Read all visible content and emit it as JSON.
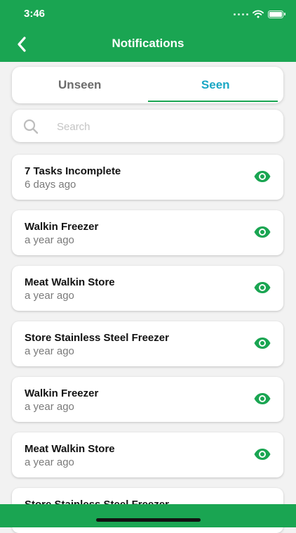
{
  "status_bar": {
    "time": "3:46"
  },
  "header": {
    "title": "Notifications"
  },
  "tabs": [
    {
      "label": "Unseen",
      "active": false
    },
    {
      "label": "Seen",
      "active": true
    }
  ],
  "search": {
    "placeholder": "Search",
    "value": ""
  },
  "notifications": [
    {
      "title": "7 Tasks Incomplete",
      "time": "6 days ago"
    },
    {
      "title": "Walkin Freezer",
      "time": "a year ago"
    },
    {
      "title": "Meat Walkin Store",
      "time": "a year ago"
    },
    {
      "title": "Store Stainless Steel Freezer",
      "time": "a year ago"
    },
    {
      "title": "Walkin Freezer",
      "time": "a year ago"
    },
    {
      "title": "Meat Walkin Store",
      "time": "a year ago"
    },
    {
      "title": "Store Stainless Steel Freezer",
      "time": ""
    }
  ],
  "icons": {
    "back": "chevron-left-icon",
    "search": "search-icon",
    "seen": "eye-icon",
    "wifi": "wifi-icon",
    "battery": "battery-icon"
  },
  "colors": {
    "brand_green": "#1aa552",
    "active_tab_text": "#1aa7c4",
    "eye_icon": "#1aa552"
  }
}
